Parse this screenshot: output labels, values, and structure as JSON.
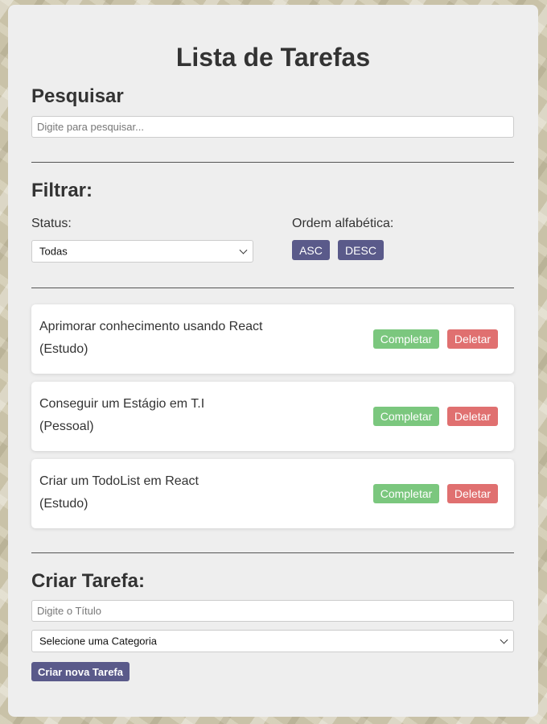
{
  "title": "Lista de Tarefas",
  "search": {
    "heading": "Pesquisar",
    "placeholder": "Digite para pesquisar..."
  },
  "filter": {
    "heading": "Filtrar:",
    "status_label": "Status:",
    "status_value": "Todas",
    "order_label": "Ordem alfabética:",
    "asc_label": "ASC",
    "desc_label": "DESC"
  },
  "tasks": [
    {
      "text": "Aprimorar conhecimento usando React",
      "category": "(Estudo)"
    },
    {
      "text": "Conseguir um Estágio em T.I",
      "category": "(Pessoal)"
    },
    {
      "text": "Criar um TodoList em React",
      "category": "(Estudo)"
    }
  ],
  "actions": {
    "complete_label": "Completar",
    "delete_label": "Deletar"
  },
  "create": {
    "heading": "Criar Tarefa:",
    "title_placeholder": "Digite o Título",
    "category_value": "Selecione uma Categoria",
    "submit_label": "Criar nova Tarefa"
  },
  "colors": {
    "primary": "#5a5a8a",
    "complete": "#7bc77e",
    "delete": "#e07070",
    "panel": "#eeeeee"
  }
}
